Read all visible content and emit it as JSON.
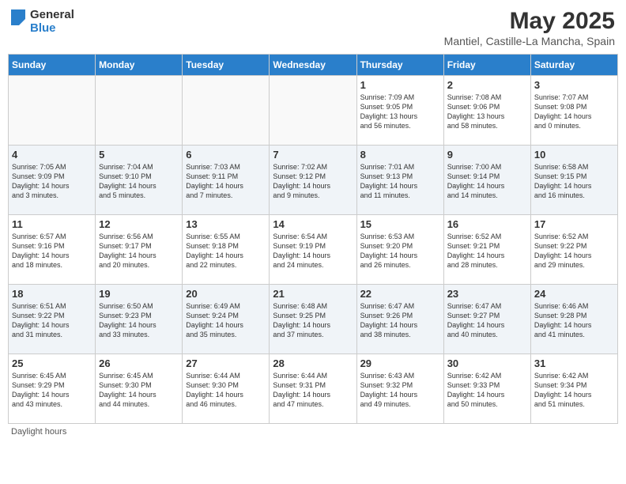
{
  "header": {
    "logo_general": "General",
    "logo_blue": "Blue",
    "month": "May 2025",
    "location": "Mantiel, Castille-La Mancha, Spain"
  },
  "days_of_week": [
    "Sunday",
    "Monday",
    "Tuesday",
    "Wednesday",
    "Thursday",
    "Friday",
    "Saturday"
  ],
  "footer": "Daylight hours",
  "weeks": [
    [
      {
        "day": "",
        "info": "",
        "empty": true
      },
      {
        "day": "",
        "info": "",
        "empty": true
      },
      {
        "day": "",
        "info": "",
        "empty": true
      },
      {
        "day": "",
        "info": "",
        "empty": true
      },
      {
        "day": "1",
        "info": "Sunrise: 7:09 AM\nSunset: 9:05 PM\nDaylight: 13 hours\nand 56 minutes."
      },
      {
        "day": "2",
        "info": "Sunrise: 7:08 AM\nSunset: 9:06 PM\nDaylight: 13 hours\nand 58 minutes."
      },
      {
        "day": "3",
        "info": "Sunrise: 7:07 AM\nSunset: 9:08 PM\nDaylight: 14 hours\nand 0 minutes."
      }
    ],
    [
      {
        "day": "4",
        "info": "Sunrise: 7:05 AM\nSunset: 9:09 PM\nDaylight: 14 hours\nand 3 minutes."
      },
      {
        "day": "5",
        "info": "Sunrise: 7:04 AM\nSunset: 9:10 PM\nDaylight: 14 hours\nand 5 minutes."
      },
      {
        "day": "6",
        "info": "Sunrise: 7:03 AM\nSunset: 9:11 PM\nDaylight: 14 hours\nand 7 minutes."
      },
      {
        "day": "7",
        "info": "Sunrise: 7:02 AM\nSunset: 9:12 PM\nDaylight: 14 hours\nand 9 minutes."
      },
      {
        "day": "8",
        "info": "Sunrise: 7:01 AM\nSunset: 9:13 PM\nDaylight: 14 hours\nand 11 minutes."
      },
      {
        "day": "9",
        "info": "Sunrise: 7:00 AM\nSunset: 9:14 PM\nDaylight: 14 hours\nand 14 minutes."
      },
      {
        "day": "10",
        "info": "Sunrise: 6:58 AM\nSunset: 9:15 PM\nDaylight: 14 hours\nand 16 minutes."
      }
    ],
    [
      {
        "day": "11",
        "info": "Sunrise: 6:57 AM\nSunset: 9:16 PM\nDaylight: 14 hours\nand 18 minutes."
      },
      {
        "day": "12",
        "info": "Sunrise: 6:56 AM\nSunset: 9:17 PM\nDaylight: 14 hours\nand 20 minutes."
      },
      {
        "day": "13",
        "info": "Sunrise: 6:55 AM\nSunset: 9:18 PM\nDaylight: 14 hours\nand 22 minutes."
      },
      {
        "day": "14",
        "info": "Sunrise: 6:54 AM\nSunset: 9:19 PM\nDaylight: 14 hours\nand 24 minutes."
      },
      {
        "day": "15",
        "info": "Sunrise: 6:53 AM\nSunset: 9:20 PM\nDaylight: 14 hours\nand 26 minutes."
      },
      {
        "day": "16",
        "info": "Sunrise: 6:52 AM\nSunset: 9:21 PM\nDaylight: 14 hours\nand 28 minutes."
      },
      {
        "day": "17",
        "info": "Sunrise: 6:52 AM\nSunset: 9:22 PM\nDaylight: 14 hours\nand 29 minutes."
      }
    ],
    [
      {
        "day": "18",
        "info": "Sunrise: 6:51 AM\nSunset: 9:22 PM\nDaylight: 14 hours\nand 31 minutes."
      },
      {
        "day": "19",
        "info": "Sunrise: 6:50 AM\nSunset: 9:23 PM\nDaylight: 14 hours\nand 33 minutes."
      },
      {
        "day": "20",
        "info": "Sunrise: 6:49 AM\nSunset: 9:24 PM\nDaylight: 14 hours\nand 35 minutes."
      },
      {
        "day": "21",
        "info": "Sunrise: 6:48 AM\nSunset: 9:25 PM\nDaylight: 14 hours\nand 37 minutes."
      },
      {
        "day": "22",
        "info": "Sunrise: 6:47 AM\nSunset: 9:26 PM\nDaylight: 14 hours\nand 38 minutes."
      },
      {
        "day": "23",
        "info": "Sunrise: 6:47 AM\nSunset: 9:27 PM\nDaylight: 14 hours\nand 40 minutes."
      },
      {
        "day": "24",
        "info": "Sunrise: 6:46 AM\nSunset: 9:28 PM\nDaylight: 14 hours\nand 41 minutes."
      }
    ],
    [
      {
        "day": "25",
        "info": "Sunrise: 6:45 AM\nSunset: 9:29 PM\nDaylight: 14 hours\nand 43 minutes."
      },
      {
        "day": "26",
        "info": "Sunrise: 6:45 AM\nSunset: 9:30 PM\nDaylight: 14 hours\nand 44 minutes."
      },
      {
        "day": "27",
        "info": "Sunrise: 6:44 AM\nSunset: 9:30 PM\nDaylight: 14 hours\nand 46 minutes."
      },
      {
        "day": "28",
        "info": "Sunrise: 6:44 AM\nSunset: 9:31 PM\nDaylight: 14 hours\nand 47 minutes."
      },
      {
        "day": "29",
        "info": "Sunrise: 6:43 AM\nSunset: 9:32 PM\nDaylight: 14 hours\nand 49 minutes."
      },
      {
        "day": "30",
        "info": "Sunrise: 6:42 AM\nSunset: 9:33 PM\nDaylight: 14 hours\nand 50 minutes."
      },
      {
        "day": "31",
        "info": "Sunrise: 6:42 AM\nSunset: 9:34 PM\nDaylight: 14 hours\nand 51 minutes."
      }
    ]
  ]
}
